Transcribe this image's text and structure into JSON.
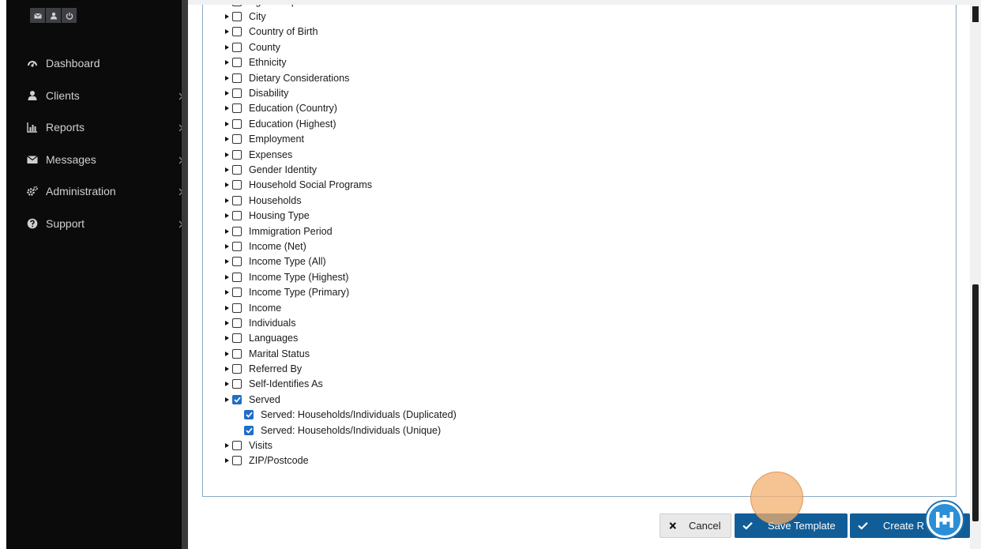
{
  "sidebar": {
    "top_icons": [
      "envelope-icon",
      "user-icon",
      "power-icon"
    ],
    "items": [
      {
        "label": "Dashboard",
        "icon": "dashboard-icon",
        "has_submenu": false
      },
      {
        "label": "Clients",
        "icon": "user-icon",
        "has_submenu": true
      },
      {
        "label": "Reports",
        "icon": "bar-chart-icon",
        "has_submenu": true
      },
      {
        "label": "Messages",
        "icon": "envelope-icon",
        "has_submenu": true
      },
      {
        "label": "Administration",
        "icon": "gears-icon",
        "has_submenu": true
      },
      {
        "label": "Support",
        "icon": "question-circle-icon",
        "has_submenu": true
      }
    ]
  },
  "fields": {
    "items": [
      {
        "label": "Age Group",
        "checked": false,
        "level": 0
      },
      {
        "label": "City",
        "checked": false,
        "level": 0
      },
      {
        "label": "Country of Birth",
        "checked": false,
        "level": 0
      },
      {
        "label": "County",
        "checked": false,
        "level": 0
      },
      {
        "label": "Ethnicity",
        "checked": false,
        "level": 0
      },
      {
        "label": "Dietary Considerations",
        "checked": false,
        "level": 0
      },
      {
        "label": "Disability",
        "checked": false,
        "level": 0
      },
      {
        "label": "Education (Country)",
        "checked": false,
        "level": 0
      },
      {
        "label": "Education (Highest)",
        "checked": false,
        "level": 0
      },
      {
        "label": "Employment",
        "checked": false,
        "level": 0
      },
      {
        "label": "Expenses",
        "checked": false,
        "level": 0
      },
      {
        "label": "Gender Identity",
        "checked": false,
        "level": 0
      },
      {
        "label": "Household Social Programs",
        "checked": false,
        "level": 0
      },
      {
        "label": "Households",
        "checked": false,
        "level": 0
      },
      {
        "label": "Housing Type",
        "checked": false,
        "level": 0
      },
      {
        "label": "Immigration Period",
        "checked": false,
        "level": 0
      },
      {
        "label": "Income (Net)",
        "checked": false,
        "level": 0
      },
      {
        "label": "Income Type (All)",
        "checked": false,
        "level": 0
      },
      {
        "label": "Income Type (Highest)",
        "checked": false,
        "level": 0
      },
      {
        "label": "Income Type (Primary)",
        "checked": false,
        "level": 0
      },
      {
        "label": "Income",
        "checked": false,
        "level": 0
      },
      {
        "label": "Individuals",
        "checked": false,
        "level": 0
      },
      {
        "label": "Languages",
        "checked": false,
        "level": 0
      },
      {
        "label": "Marital Status",
        "checked": false,
        "level": 0
      },
      {
        "label": "Referred By",
        "checked": false,
        "level": 0
      },
      {
        "label": "Self-Identifies As",
        "checked": false,
        "level": 0
      },
      {
        "label": "Served",
        "checked": true,
        "level": 0
      },
      {
        "label": "Served: Households/Individuals (Duplicated)",
        "checked": true,
        "level": 1
      },
      {
        "label": "Served: Households/Individuals (Unique)",
        "checked": true,
        "level": 1
      },
      {
        "label": "Visits",
        "checked": false,
        "level": 0
      },
      {
        "label": "ZIP/Postcode",
        "checked": false,
        "level": 0
      }
    ]
  },
  "footer": {
    "cancel_label": "Cancel",
    "save_template_label": "Save Template",
    "create_label": "Create R"
  },
  "colors": {
    "sidebar_bg": "#0b0b0b",
    "primary_button": "#115d97",
    "checkbox_checked": "#1e6fc7",
    "panel_border": "#8aaac5"
  }
}
